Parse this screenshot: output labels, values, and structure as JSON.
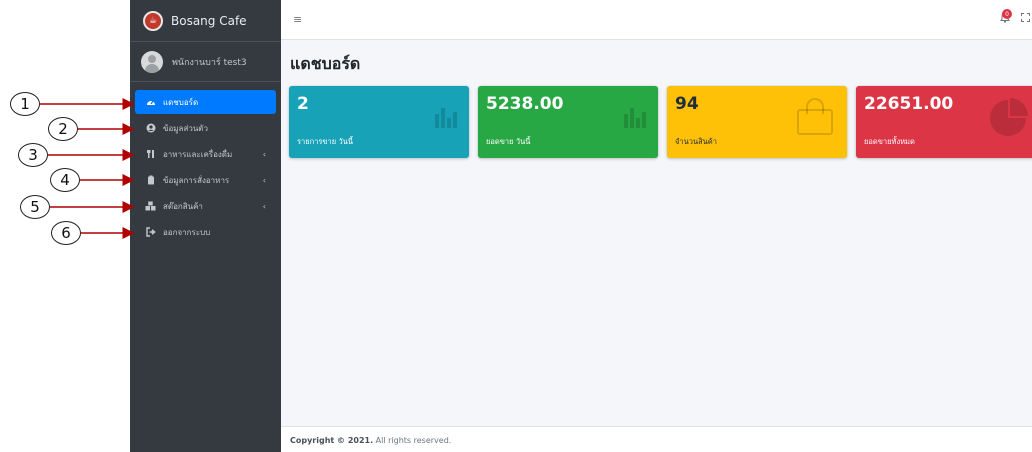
{
  "brand": {
    "name": "Bosang Cafe"
  },
  "user": {
    "name": "พนักงานบาร์ test3"
  },
  "sidebar": {
    "items": [
      {
        "label": "แดชบอร์ด",
        "icon": "dashboard-icon",
        "active": true,
        "has_arrow": false
      },
      {
        "label": "ข้อมูลส่วนตัว",
        "icon": "user-circle-icon",
        "active": false,
        "has_arrow": false
      },
      {
        "label": "อาหารและเครื่องดื่ม",
        "icon": "utensils-icon",
        "active": false,
        "has_arrow": true
      },
      {
        "label": "ข้อมูลการสั่งอาหาร",
        "icon": "clipboard-icon",
        "active": false,
        "has_arrow": true
      },
      {
        "label": "สต๊อกสินค้า",
        "icon": "boxes-icon",
        "active": false,
        "has_arrow": true
      },
      {
        "label": "ออกจากระบบ",
        "icon": "sign-out-icon",
        "active": false,
        "has_arrow": false
      }
    ],
    "arrow_glyph": "‹"
  },
  "topbar": {
    "menu_glyph": "≡",
    "notification_count": "0",
    "bell_glyph": "🔔",
    "expand_glyph": "⛶"
  },
  "main": {
    "title": "แดชบอร์ด"
  },
  "boxes": [
    {
      "value": "2",
      "label": "รายการขาย วันนี้",
      "color": "#17a2b8",
      "icon": "bar-chart-icon"
    },
    {
      "value": "5238.00",
      "label": "ยอดขาย วันนี้",
      "color": "#28a745",
      "icon": "bar-chart-icon"
    },
    {
      "value": "94",
      "label": "จำนวนสินค้า",
      "color": "#ffc107",
      "icon": "shopping-bag-icon"
    },
    {
      "value": "22651.00",
      "label": "ยอดขายทั้งหมด",
      "color": "#dc3545",
      "icon": "pie-chart-icon"
    }
  ],
  "footer": {
    "copyright": "Copyright © 2021.",
    "rights": "All rights reserved."
  },
  "annotations": [
    "1",
    "2",
    "3",
    "4",
    "5",
    "6"
  ],
  "colors": {
    "sidebar_bg": "#343a40",
    "active": "#007bff",
    "annotation_arrow": "#b00000"
  }
}
